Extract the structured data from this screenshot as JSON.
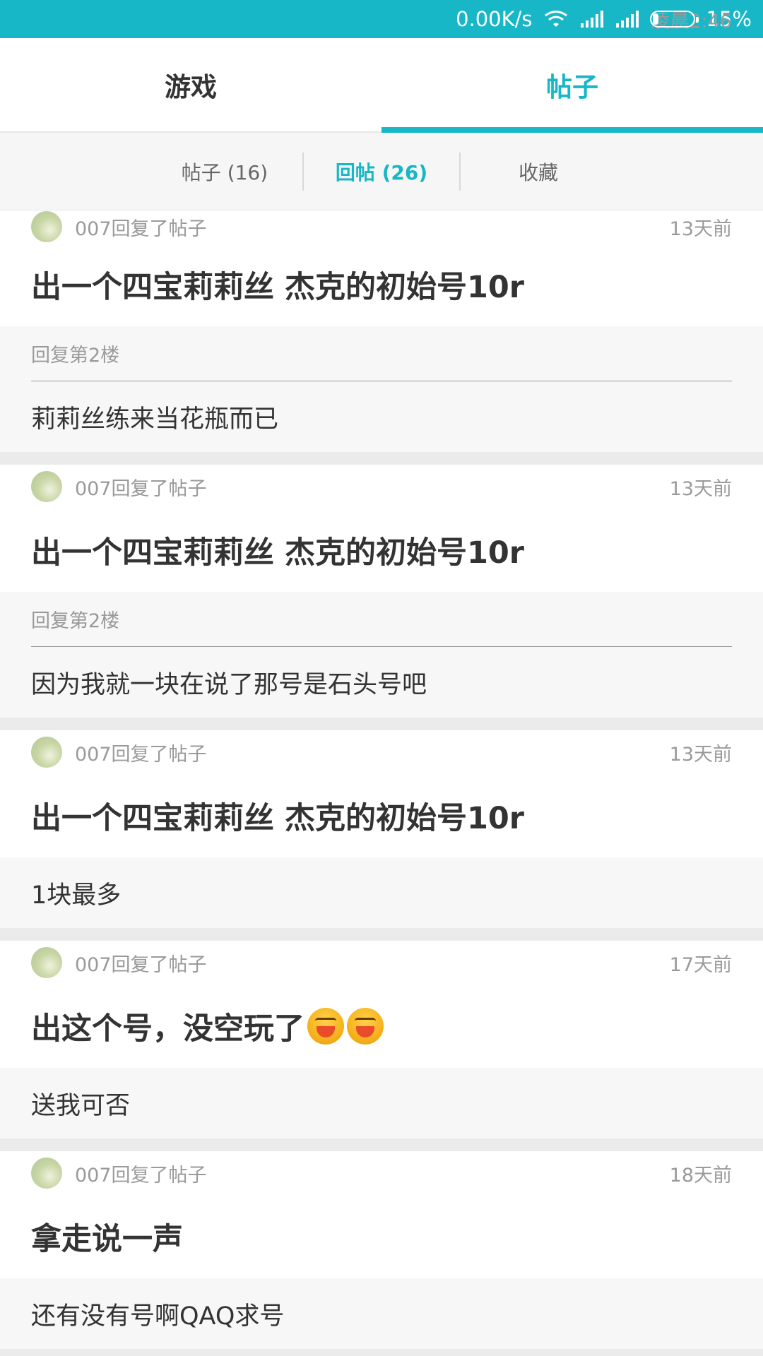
{
  "status_bar": {
    "time": "凌晨2:46",
    "net_speed": "0.00K/s",
    "battery_text": "15%",
    "battery_level": 0.15,
    "icons": [
      "wifi-icon",
      "signal-icon",
      "signal-icon",
      "battery-icon"
    ]
  },
  "top_tabs": [
    {
      "label": "游戏",
      "active": false
    },
    {
      "label": "帖子",
      "active": true
    }
  ],
  "sub_tabs": [
    {
      "label": "帖子 (16)",
      "active": false
    },
    {
      "label": "回帖 (26)",
      "active": true
    },
    {
      "label": "收藏",
      "active": false
    }
  ],
  "colors": {
    "accent": "#17b7c8",
    "divider": "#ebebeb"
  },
  "items": [
    {
      "meta": "007回复了帖子",
      "time": "13天前",
      "title": "出一个四宝莉莉丝 杰克的初始号10r",
      "quote": "回复第2楼",
      "reply": "莉莉丝练来当花瓶而已"
    },
    {
      "meta": "007回复了帖子",
      "time": "13天前",
      "title": "出一个四宝莉莉丝 杰克的初始号10r",
      "quote": "回复第2楼",
      "reply": "因为我就一块在说了那号是石头号吧"
    },
    {
      "meta": "007回复了帖子",
      "time": "13天前",
      "title": "出一个四宝莉莉丝 杰克的初始号10r",
      "reply": "1块最多"
    },
    {
      "meta": "007回复了帖子",
      "time": "17天前",
      "title": "出这个号，没空玩了",
      "title_emoji_count": 2,
      "reply": "送我可否"
    },
    {
      "meta": "007回复了帖子",
      "time": "18天前",
      "title": "拿走说一声",
      "reply": "还有没有号啊QAQ求号"
    }
  ]
}
